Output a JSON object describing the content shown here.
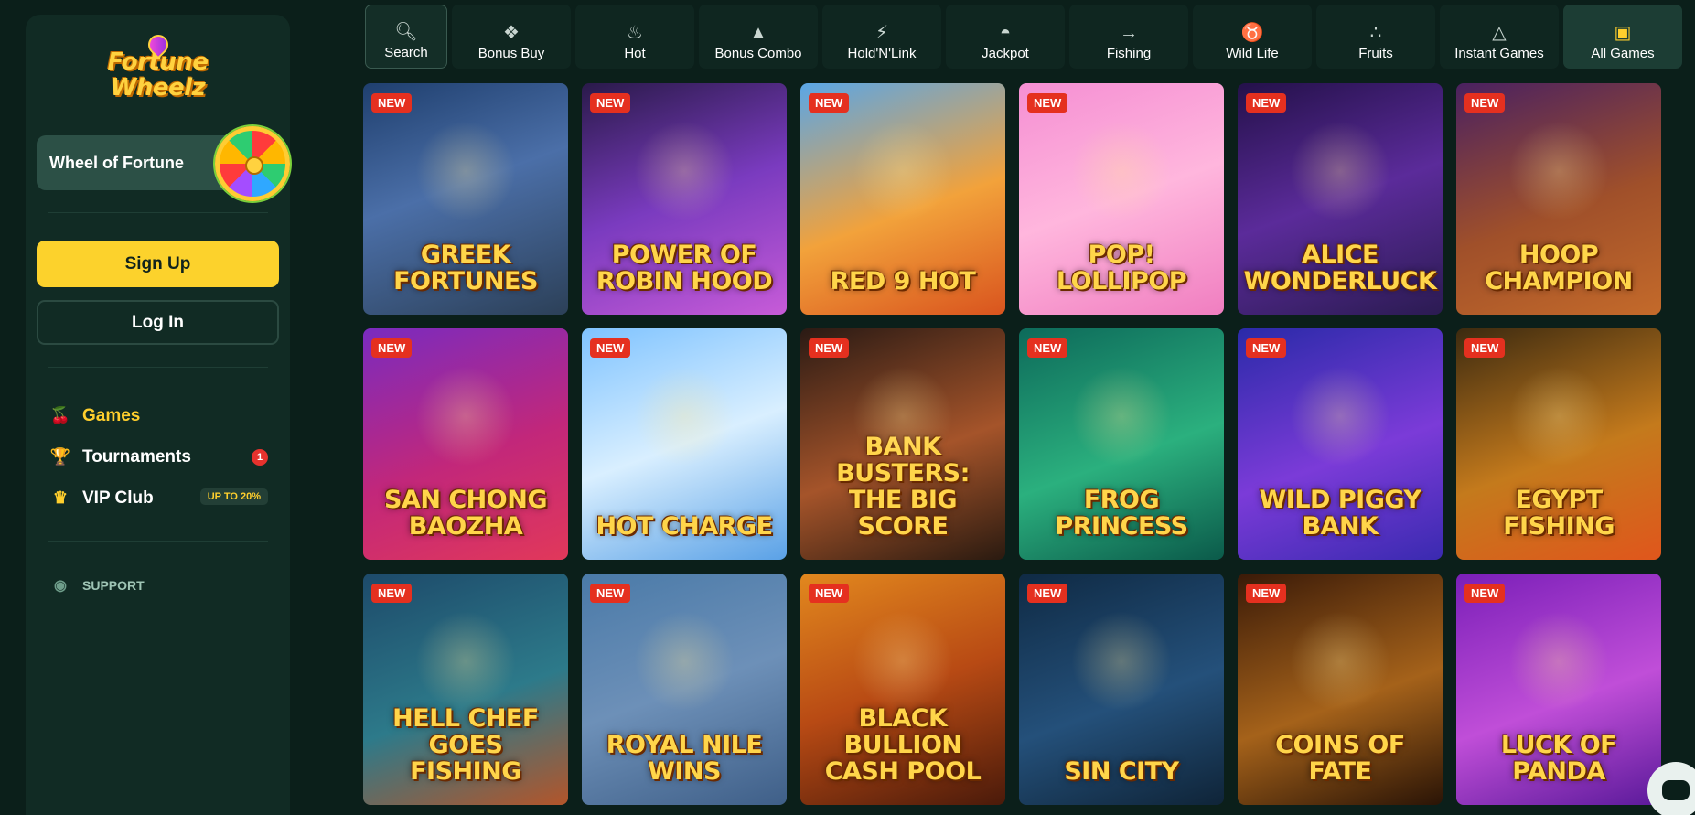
{
  "brand": {
    "line1": "Fortune",
    "line2": "Wheelz"
  },
  "sidebar": {
    "wheel_label": "Wheel of Fortune",
    "signup": "Sign Up",
    "login": "Log In",
    "nav": [
      {
        "label": "Games",
        "icon": "cherries-icon"
      },
      {
        "label": "Tournaments",
        "icon": "trophy-icon",
        "badge": "1"
      },
      {
        "label": "VIP Club",
        "icon": "crown-icon",
        "tag": "UP TO 20%"
      }
    ],
    "support": "SUPPORT"
  },
  "tabs": [
    {
      "label": "Search",
      "icon": "search-icon"
    },
    {
      "label": "Bonus Buy",
      "icon": "gift-icon"
    },
    {
      "label": "Hot",
      "icon": "flame-icon"
    },
    {
      "label": "Bonus Combo",
      "icon": "money-bag-icon"
    },
    {
      "label": "Hold'N'Link",
      "icon": "bolt-icon"
    },
    {
      "label": "Jackpot",
      "icon": "jackpot-icon"
    },
    {
      "label": "Fishing",
      "icon": "fish-icon"
    },
    {
      "label": "Wild Life",
      "icon": "bull-icon"
    },
    {
      "label": "Fruits",
      "icon": "grapes-icon"
    },
    {
      "label": "Instant Games",
      "icon": "pyramid-icon"
    },
    {
      "label": "All Games",
      "icon": "slot-machine-icon",
      "active": true
    }
  ],
  "badge_new": "NEW",
  "colors": {
    "accent": "#fcd22c",
    "bg": "#0b1f1a",
    "panel": "#112b24",
    "new_badge": "#e5301f"
  },
  "games": [
    {
      "title": "Greek Fortunes",
      "bg": "linear-gradient(160deg,#1f3f6e,#4b6fa8 45%,#2c4058)"
    },
    {
      "title": "Power of Robin Hood",
      "bg": "linear-gradient(160deg,#2a1a4a,#7a3bbf 50%,#c75bd8)"
    },
    {
      "title": "Red 9 Hot",
      "bg": "linear-gradient(160deg,#5aa6e6,#f2a23b 55%,#d9541e)"
    },
    {
      "title": "Pop! Lollipop",
      "bg": "linear-gradient(160deg,#f58fd3,#ffb6dd 50%,#f07ec0)"
    },
    {
      "title": "Alice WonderLuck",
      "bg": "linear-gradient(160deg,#24114a,#5b2b9a 50%,#2b1b52)"
    },
    {
      "title": "Hoop Champion",
      "bg": "linear-gradient(160deg,#4a2160,#a0502a 55%,#c46a2a)"
    },
    {
      "title": "San Chong Baozha",
      "bg": "linear-gradient(160deg,#7a2bbf,#c2277a 55%,#e1385a)"
    },
    {
      "title": "Hot Charge",
      "bg": "linear-gradient(160deg,#7fc3ff,#d9efff 50%,#5aa1e6)"
    },
    {
      "title": "Bank Busters: The Big Score",
      "bg": "linear-gradient(160deg,#2a1a14,#a5542a 55%,#2a1a10)"
    },
    {
      "title": "Frog Princess",
      "bg": "linear-gradient(160deg,#0d6a5a,#2bb07e 55%,#0b5a4a)"
    },
    {
      "title": "Wild Piggy Bank",
      "bg": "linear-gradient(160deg,#2a2aa8,#7b3bd8 55%,#3a2ab0)"
    },
    {
      "title": "Egypt Fishing",
      "bg": "linear-gradient(160deg,#3c2a10,#c47a1c 55%,#e0561c)"
    },
    {
      "title": "Hell Chef Goes Fishing",
      "bg": "linear-gradient(160deg,#1d4a6a,#2d7a8a 55%,#b3552a)"
    },
    {
      "title": "Royal Nile Wins",
      "bg": "linear-gradient(160deg,#4a7aa8,#6d90b8 50%,#3f5f88)"
    },
    {
      "title": "Black Bullion Cash Pool",
      "bg": "linear-gradient(160deg,#e2881e,#b84a14 50%,#4a1a0a)"
    },
    {
      "title": "Sin City",
      "bg": "linear-gradient(160deg,#0f2a44,#24507a 55%,#0f2438)"
    },
    {
      "title": "Coins of Fate",
      "bg": "linear-gradient(160deg,#3a1a08,#a5621a 55%,#2a1406)"
    },
    {
      "title": "Luck of Panda",
      "bg": "linear-gradient(160deg,#7a1fb8,#c04ed8 55%,#5b1a9a)"
    }
  ]
}
